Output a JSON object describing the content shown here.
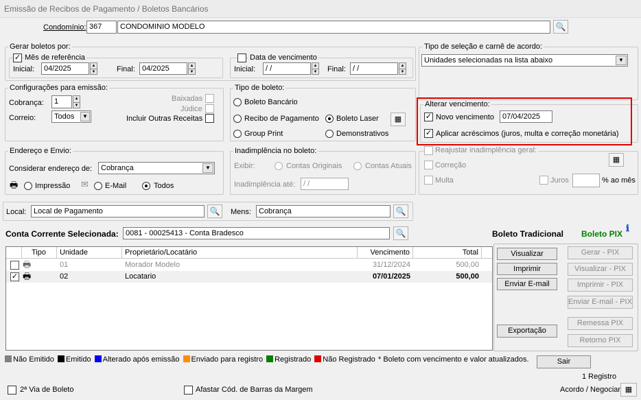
{
  "window": {
    "title": "Emissão de Recibos de Pagamento / Boletos Bancários"
  },
  "condominio": {
    "label": "Condomínio:",
    "code": "367",
    "name": "CONDOMINIO MODELO"
  },
  "gerar": {
    "title": "Gerar boletos por:",
    "mes_ref": {
      "label": "Mês de referência",
      "inicial_label": "Inicial:",
      "inicial": "04/2025",
      "final_label": "Final:",
      "final": "04/2025"
    },
    "data_venc": {
      "label": "Data de vencimento",
      "inicial_label": "Inicial:",
      "inicial": " / /",
      "final_label": "Final:",
      "final": " / /"
    }
  },
  "tipo_selecao": {
    "title": "Tipo de seleção e carnê de acordo:",
    "value": "Unidades selecionadas na lista abaixo"
  },
  "config": {
    "title": "Configurações para emissão:",
    "cobranca_label": "Cobrança:",
    "cobranca": "1",
    "correio_label": "Correio:",
    "correio": "Todos",
    "baixadas": "Baixadas",
    "judice": "Júdice",
    "outras": "Incluir Outras Receitas"
  },
  "tipo_boleto": {
    "title": "Tipo de boleto:",
    "bancario": "Boleto Bancário",
    "recibo": "Recibo de Pagamento",
    "laser": "Boleto Laser",
    "group": "Group Print",
    "demonstrativos": "Demonstrativos"
  },
  "alterar": {
    "title": "Alterar vencimento:",
    "novo_label": "Novo vencimento",
    "novo": "07/04/2025",
    "acrescimos": "Aplicar acréscimos (juros, multa e correção monetária)"
  },
  "endereco": {
    "title": "Endereço e Envio:",
    "considerar_label": "Considerar endereço de:",
    "considerar": "Cobrança",
    "impressao": "Impressão",
    "email": "E-Mail",
    "todos": "Todos"
  },
  "inadimplencia": {
    "title": "Inadimplência no boleto:",
    "exibir": "Exibir:",
    "originais": "Contas Originais",
    "atuais": "Contas Atuais",
    "ate_label": "Inadimplência até:",
    "ate": " / /"
  },
  "reajustar": {
    "label": "Reajustar inadimplência geral:",
    "correcao": "Correção",
    "multa": "Multa",
    "juros": "Juros",
    "juros_value": "",
    "pct": "% ao mês"
  },
  "local": {
    "label": "Local:",
    "value": "Local de Pagamento"
  },
  "mens": {
    "label": "Mens:",
    "value": "Cobrança"
  },
  "conta": {
    "label": "Conta Corrente Selecionada:",
    "value": "0081 - 00025413 - Conta Bradesco"
  },
  "boleto_tradicional": "Boleto Tradicional",
  "boleto_pix": "Boleto PIX",
  "table": {
    "headers": [
      "Tipo",
      "Unidade",
      "Proprietário/Locatário",
      "Vencimento",
      "Total"
    ],
    "rows": [
      {
        "checked": false,
        "unidade": "01",
        "nome": "Morador Modelo",
        "vencimento": "31/12/2024",
        "total": "500,00"
      },
      {
        "checked": true,
        "unidade": "02",
        "nome": "Locatario",
        "vencimento": "07/01/2025",
        "total": "500,00"
      }
    ]
  },
  "buttons": {
    "visualizar": "Visualizar",
    "imprimir": "Imprimir",
    "enviar_email": "Enviar E-mail",
    "exportacao": "Exportação",
    "gerar_pix": "Gerar - PIX",
    "visualizar_pix": "Visualizar - PIX",
    "imprimir_pix": "Imprimir - PIX",
    "enviar_pix": "Enviar E-mail - PIX",
    "remessa_pix": "Remessa PIX",
    "retorno_pix": "Retorno PIX",
    "sair": "Sair"
  },
  "legend": [
    {
      "label": "Não Emitido",
      "color": "#808080"
    },
    {
      "label": "Emitido",
      "color": "#000000"
    },
    {
      "label": "Alterado após emissão",
      "color": "#0000ff"
    },
    {
      "label": "Enviado para registro",
      "color": "#ff8c00"
    },
    {
      "label": "Registrado",
      "color": "#008000"
    },
    {
      "label": "Não Registrado",
      "color": "#e00000"
    }
  ],
  "legend_note": "* Boleto com vencimento e valor atualizados.",
  "registros": "1 Registro",
  "footer": {
    "segunda_via": "2ª Via de Boleto",
    "afastar": "Afastar Cód. de Barras da Margem",
    "acordo": "Acordo / Negociar"
  },
  "colors": {
    "highlight": "#e00000",
    "pix_green": "#008000"
  }
}
